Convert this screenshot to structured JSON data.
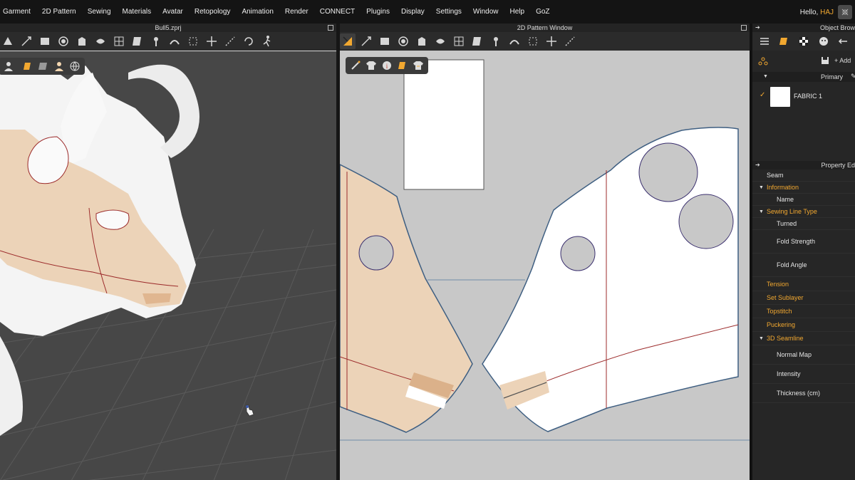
{
  "menu": {
    "items": [
      "Garment",
      "2D Pattern",
      "Sewing",
      "Materials",
      "Avatar",
      "Retopology",
      "Animation",
      "Render",
      "CONNECT",
      "Plugins",
      "Display",
      "Settings",
      "Window",
      "Help",
      "GoZ"
    ],
    "greeting": "Hello,",
    "username": "HAJ"
  },
  "viewport3d": {
    "title": "Bull5.zprj"
  },
  "pattern2d": {
    "title": "2D Pattern Window"
  },
  "object_browser": {
    "title": "Object Brow",
    "add_label": "+ Add",
    "primary_label": "Primary",
    "fabric_name": "FABRIC 1",
    "fabric_color": "#ffffff"
  },
  "property_editor": {
    "title": "Property Ed",
    "rows": {
      "seam": "Seam",
      "information": "Information",
      "name": "Name",
      "sewing_line_type": "Sewing Line Type",
      "turned": "Turned",
      "fold_strength": "Fold Strength",
      "fold_angle": "Fold Angle",
      "tension": "Tension",
      "set_sublayer": "Set Sublayer",
      "topstitch": "Topstitch",
      "puckering": "Puckering",
      "seamline_3d": "3D Seamline",
      "normal_map": "Normal Map",
      "intensity": "Intensity",
      "thickness": "Thickness (cm)"
    }
  },
  "colors": {
    "accent": "#f2a830",
    "fabric_tan": "#ecd3b8",
    "pattern_outline": "#3f5f82",
    "seam_line": "#9c2b2b",
    "viewport_bg": "#474747",
    "pattern_bg": "#c8c8c8"
  },
  "icons": {
    "toolbar3d": [
      "select-mesh-icon",
      "transform-icon",
      "edit-pattern-icon",
      "avatar-icon",
      "garment-icon",
      "tack-icon",
      "grid-icon",
      "fold-icon",
      "pin-icon",
      "steam-icon",
      "select-icon",
      "move-icon",
      "measure-icon",
      "rotate-icon",
      "walk-icon"
    ],
    "toolbar2d": [
      "transform-pattern-icon",
      "edit-curve-icon",
      "rectangle-icon",
      "circle-icon",
      "internal-shape-icon",
      "trace-icon",
      "grid-pattern-icon",
      "sew-icon",
      "shirt-icon",
      "brush-icon",
      "segment-icon",
      "free-sew-icon",
      "measure-ruler-icon"
    ]
  }
}
